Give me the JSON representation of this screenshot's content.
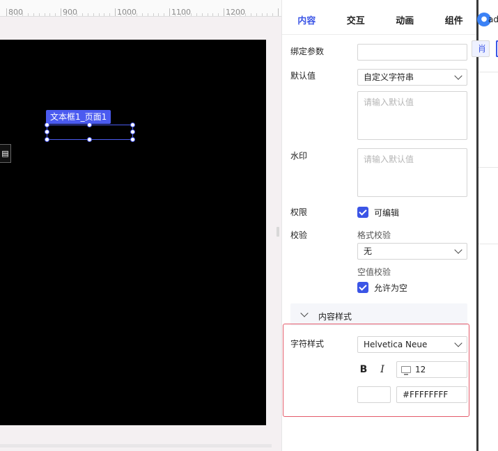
{
  "ruler": {
    "labels": [
      "800",
      "900",
      "1000",
      "1100",
      "1200"
    ]
  },
  "canvas": {
    "background_color": "#000000",
    "selected_element_tag": "文本框1_页面1"
  },
  "panel": {
    "tabs": [
      {
        "label": "内容",
        "active": true
      },
      {
        "label": "交互",
        "active": false
      },
      {
        "label": "动画",
        "active": false
      },
      {
        "label": "组件",
        "active": false
      }
    ],
    "bind_params_label": "绑定参数",
    "bind_params_value": "",
    "default_value_label": "默认值",
    "default_value_type": "自定义字符串",
    "default_value_placeholder": "请输入默认值",
    "watermark_label": "水印",
    "watermark_placeholder": "请输入默认值",
    "permission_label": "权限",
    "editable_label": "可编辑",
    "editable_checked": true,
    "validation_label": "校验",
    "format_validation_label": "格式校验",
    "format_validation_value": "无",
    "empty_validation_label": "空值校验",
    "allow_empty_label": "允许为空",
    "allow_empty_checked": true,
    "content_style_section": "内容样式",
    "char_style_label": "字符样式",
    "font_family_value": "Helvetica Neue",
    "bold_label": "B",
    "italic_label": "I",
    "font_size_value": "12",
    "color_value": "#FFFFFFFF"
  },
  "accent_color": "#3b55e6",
  "highlight_color": "#e35a6a",
  "right_strip": {
    "user_name": "adı",
    "cancel_text": "肖"
  }
}
